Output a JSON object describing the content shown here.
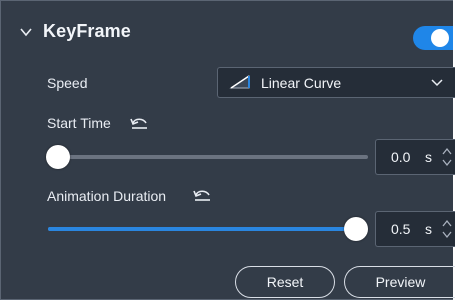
{
  "panel": {
    "title": "KeyFrame",
    "enabled": true,
    "accent_color": "#1f86e8"
  },
  "speed": {
    "label": "Speed",
    "value": "Linear Curve",
    "icon": "linear-curve-icon"
  },
  "start_time": {
    "label": "Start Time",
    "reset_icon": "undo-icon",
    "value": "0.0",
    "unit": "s",
    "slider_fraction": 0.0
  },
  "duration": {
    "label": "Animation Duration",
    "reset_icon": "undo-icon",
    "value": "0.5",
    "unit": "s",
    "slider_fraction": 1.0
  },
  "buttons": {
    "reset": "Reset",
    "preview": "Preview"
  }
}
